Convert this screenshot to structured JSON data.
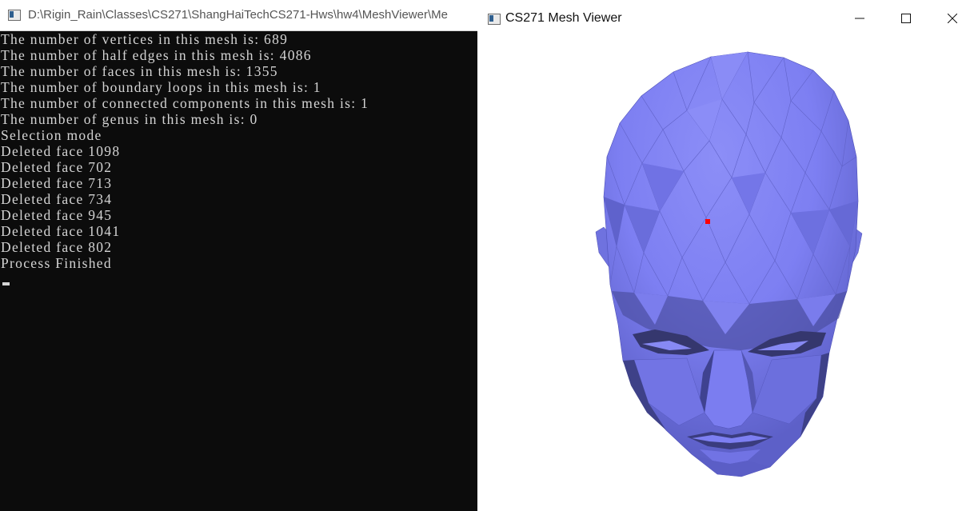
{
  "console": {
    "title": "D:\\Rigin_Rain\\Classes\\CS271\\ShangHaiTechCS271-Hws\\hw4\\MeshViewer\\Me",
    "lines": [
      "The number of vertices in this mesh is: 689",
      "The number of half edges in this mesh is: 4086",
      "The number of faces in this mesh is: 1355",
      "The number of boundary loops in this mesh is: 1",
      "The number of connected components in this mesh is: 1",
      "The number of genus in this mesh is: 0",
      "Selection mode",
      "Deleted face 1098",
      "Deleted face 702",
      "Deleted face 713",
      "Deleted face 734",
      "Deleted face 945",
      "Deleted face 1041",
      "Deleted face 802",
      "Process Finished"
    ]
  },
  "viewer": {
    "title": "CS271 Mesh Viewer",
    "mesh_color": "#7d7ff2",
    "selection_color": "#ff0000",
    "window_buttons": [
      "minimize-icon",
      "maximize-icon",
      "close-icon"
    ]
  }
}
